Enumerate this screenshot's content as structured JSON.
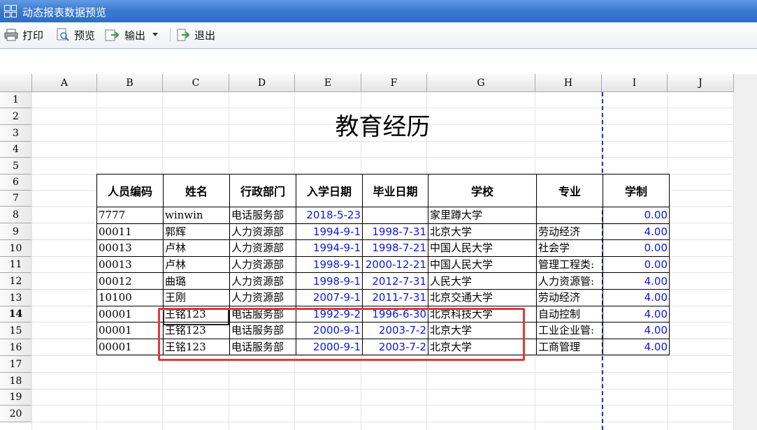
{
  "window": {
    "title": "动态报表数据预览"
  },
  "toolbar": {
    "print_label": "打印",
    "preview_label": "预览",
    "export_label": "输出",
    "exit_label": "退出"
  },
  "sheet": {
    "columns": [
      "A",
      "B",
      "C",
      "D",
      "E",
      "F",
      "G",
      "H",
      "I",
      "J"
    ],
    "rows": [
      "1",
      "2",
      "3",
      "4",
      "5",
      "6",
      "7",
      "8",
      "9",
      "10",
      "11",
      "12",
      "13",
      "14",
      "15",
      "16",
      "17",
      "18",
      "19",
      "20"
    ],
    "active_row": "14"
  },
  "report": {
    "title": "教育经历",
    "headers": [
      "人员编码",
      "姓名",
      "行政部门",
      "入学日期",
      "毕业日期",
      "学校",
      "专业",
      "学制"
    ],
    "rows": [
      [
        "7777",
        "winwin",
        "电话服务部",
        "2018-5-23",
        "",
        "家里蹲大学",
        "",
        "0.00"
      ],
      [
        "00011",
        "郭辉",
        "人力资源部",
        "1994-9-1",
        "1998-7-31",
        "北京大学",
        "劳动经济",
        "4.00"
      ],
      [
        "00013",
        "卢林",
        "人力资源部",
        "1994-9-1",
        "1998-7-21",
        "中国人民大学",
        "社会学",
        "0.00"
      ],
      [
        "00013",
        "卢林",
        "人力资源部",
        "1998-9-1",
        "2000-12-21",
        "中国人民大学",
        "管理工程类:",
        "0.00"
      ],
      [
        "00012",
        "曲璐",
        "人力资源部",
        "1998-9-1",
        "2012-7-31",
        "人民大学",
        "人力资源管:",
        "4.00"
      ],
      [
        "10100",
        "王刚",
        "人力资源部",
        "2007-9-1",
        "2011-7-31",
        "北京交通大学",
        "劳动经济",
        "4.00"
      ],
      [
        "00001",
        "王铭123",
        "电话服务部",
        "1992-9-2",
        "1996-6-30",
        "北京科技大学",
        "自动控制",
        "4.00"
      ],
      [
        "00001",
        "王铭123",
        "电话服务部",
        "2000-9-1",
        "2003-7-2",
        "北京大学",
        "工业企业管:",
        "4.00"
      ],
      [
        "00001",
        "王铭123",
        "电话服务部",
        "2000-9-1",
        "2003-7-2",
        "北京大学",
        "工商管理",
        "4.00"
      ]
    ]
  },
  "colors": {
    "accent_blue": "#0b18e6",
    "highlight_red": "#e03a3a",
    "titlebar": "#3d7bd2"
  }
}
